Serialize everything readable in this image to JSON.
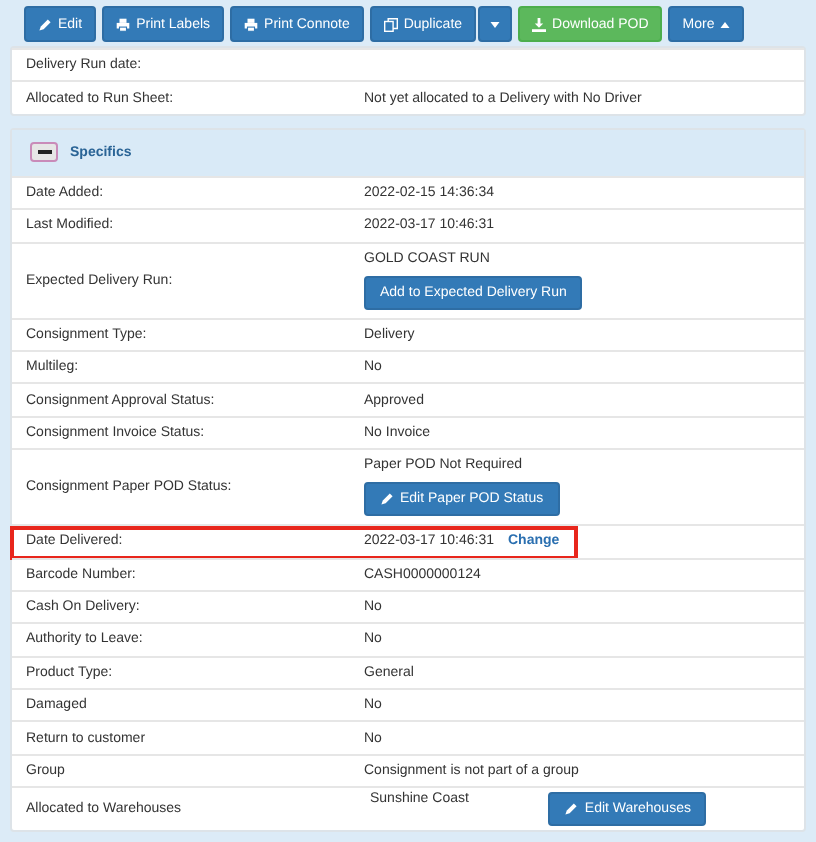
{
  "toolbar": [
    {
      "label": "Edit",
      "kind": "primary"
    },
    {
      "label": "Print Labels",
      "kind": "primary"
    },
    {
      "label": "Print Connote",
      "kind": "primary"
    },
    {
      "label": "Duplicate",
      "kind": "primary",
      "split": true
    },
    {
      "label": "Download POD",
      "kind": "success"
    },
    {
      "label": "More",
      "kind": "primary"
    }
  ],
  "run_panel": {
    "rows": [
      {
        "label": "Delivery Run date:",
        "kind": "text"
      },
      {
        "label": "Allocated to Run Sheet:",
        "kind": "text",
        "value": "Not yet allocated to a Delivery with No Driver"
      }
    ]
  },
  "specifics": {
    "title": "Specifics",
    "expanded": true,
    "rows": [
      {
        "label": "Date Added:",
        "kind": "text",
        "value": "2022-02-15 14:36:34"
      },
      {
        "label": "Last Modified:",
        "kind": "text",
        "value": "2022-03-17 10:46:31"
      },
      {
        "label": "Expected Delivery Run:",
        "kind": "stacked",
        "value": "GOLD COAST RUN",
        "button": "Add to Expected Delivery Run"
      },
      {
        "label": "Consignment Type:",
        "kind": "text",
        "value": "Delivery"
      },
      {
        "label": "Multileg:",
        "kind": "text",
        "value": "No"
      },
      {
        "label": "Consignment Approval Status:",
        "kind": "text",
        "value": "Approved"
      },
      {
        "label": "Consignment Invoice Status:",
        "kind": "text",
        "value": "No Invoice"
      },
      {
        "label": "Consignment Paper POD Status:",
        "kind": "stacked-edit",
        "value": "Paper POD Not Required",
        "button": "Edit Paper POD Status"
      },
      {
        "label": "Date Delivered:",
        "kind": "link",
        "value": "2022-03-17 10:46:31",
        "link": "Change",
        "highlighted": true
      },
      {
        "label": "Barcode Number:",
        "kind": "text",
        "value": "CASH0000000124"
      },
      {
        "label": "Cash On Delivery:",
        "kind": "text",
        "value": "No"
      },
      {
        "label": "Authority to Leave:",
        "kind": "text",
        "value": "No"
      },
      {
        "label": "Product Type:",
        "kind": "text",
        "value": "General"
      },
      {
        "label": "Damaged",
        "kind": "text",
        "value": "No"
      },
      {
        "label": "Return to customer",
        "kind": "text",
        "value": "No"
      },
      {
        "label": "Group",
        "kind": "text",
        "value": "Consignment is not part of a group"
      },
      {
        "label": "Allocated to Warehouses",
        "kind": "inline-edit",
        "value": "Sunshine Coast",
        "button": "Edit Warehouses"
      }
    ]
  }
}
